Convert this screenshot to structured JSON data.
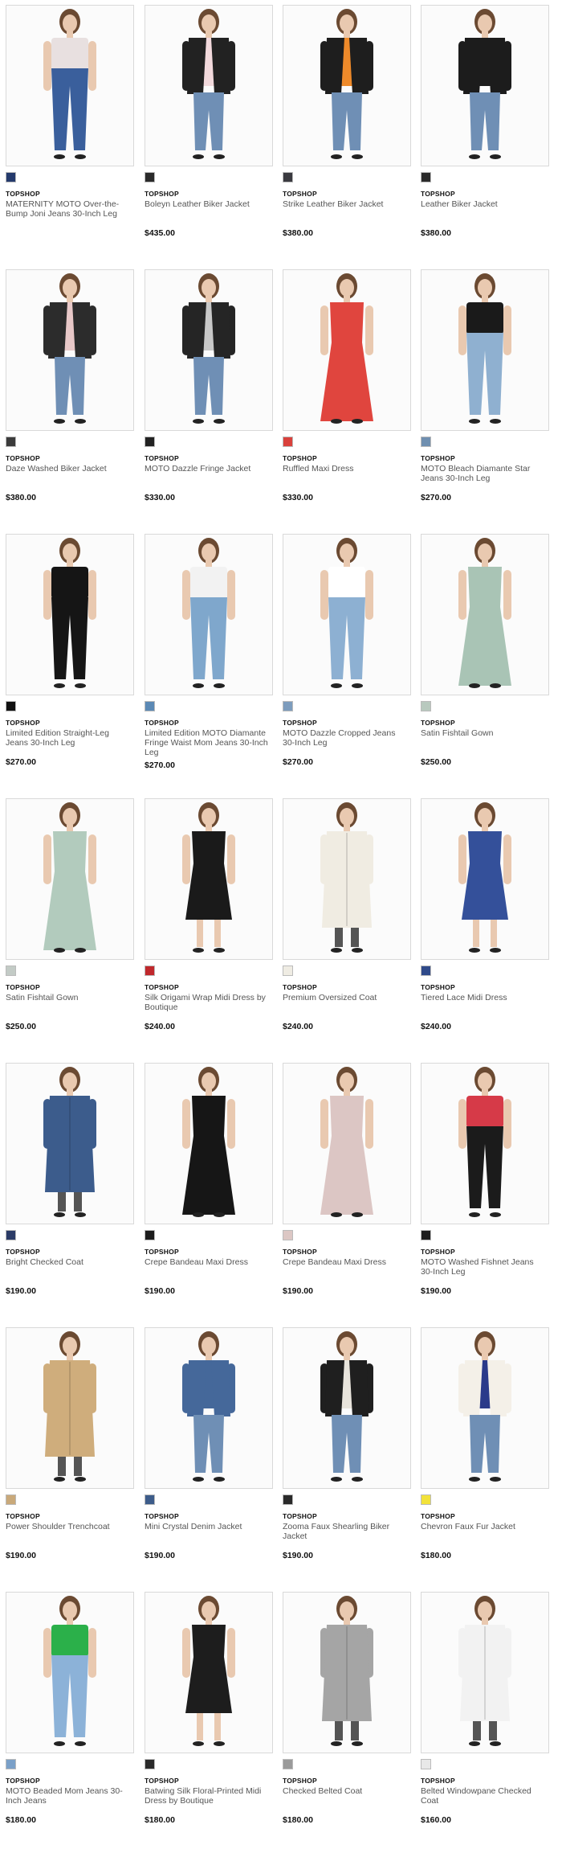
{
  "products": [
    {
      "brand": "TOPSHOP",
      "name": "MATERNITY MOTO Over-the-Bump Joni Jeans 30-Inch Leg",
      "price": "",
      "swatch": "#243a6c",
      "garment": "#3a5f9c",
      "top": "#e8e0e0",
      "style": "jeans"
    },
    {
      "brand": "TOPSHOP",
      "name": "Boleyn Leather Biker Jacket",
      "price": "$435.00",
      "swatch": "#2a2a2a",
      "garment": "#222222",
      "top": "#f2d9dc",
      "style": "jacket"
    },
    {
      "brand": "TOPSHOP",
      "name": "Strike Leather Biker Jacket",
      "price": "$380.00",
      "swatch": "#3a3a40",
      "garment": "#1e1e1e",
      "top": "#ee8a2a",
      "style": "jacket"
    },
    {
      "brand": "TOPSHOP",
      "name": "Leather Biker Jacket",
      "price": "$380.00",
      "swatch": "#2b2b2b",
      "garment": "#1c1c1c",
      "top": "#1c1c1c",
      "style": "jacket"
    },
    {
      "brand": "TOPSHOP",
      "name": "Daze Washed Biker Jacket",
      "price": "$380.00",
      "swatch": "#3b3b3b",
      "garment": "#2c2c2c",
      "top": "#e8c8c8",
      "style": "jacket"
    },
    {
      "brand": "TOPSHOP",
      "name": "MOTO Dazzle Fringe Jacket",
      "price": "$330.00",
      "swatch": "#222222",
      "garment": "#252525",
      "top": "#c8c8c8",
      "style": "jacket"
    },
    {
      "brand": "TOPSHOP",
      "name": "Ruffled Maxi Dress",
      "price": "$330.00",
      "swatch": "#d9413c",
      "garment": "#e0453e",
      "top": "#e0453e",
      "style": "gown"
    },
    {
      "brand": "TOPSHOP",
      "name": "MOTO Bleach Diamante Star Jeans 30-Inch Leg",
      "price": "$270.00",
      "swatch": "#6f8fb0",
      "garment": "#8fb0d0",
      "top": "#1a1a1a",
      "style": "jeans"
    },
    {
      "brand": "TOPSHOP",
      "name": "Limited Edition Straight-Leg Jeans 30-Inch Leg",
      "price": "$270.00",
      "swatch": "#111111",
      "garment": "#151515",
      "top": "#151515",
      "style": "jeans"
    },
    {
      "brand": "TOPSHOP",
      "name": "Limited Edition MOTO Diamante Fringe Waist Mom Jeans 30-Inch Leg",
      "price": "$270.00",
      "swatch": "#5b89b5",
      "garment": "#7fa7cc",
      "top": "#f2f2f2",
      "style": "jeans"
    },
    {
      "brand": "TOPSHOP",
      "name": "MOTO Dazzle Cropped Jeans 30-Inch Leg",
      "price": "$270.00",
      "swatch": "#7d9cbd",
      "garment": "#8db0d2",
      "top": "#ffffff",
      "style": "jeans"
    },
    {
      "brand": "TOPSHOP",
      "name": "Satin Fishtail Gown",
      "price": "$250.00",
      "swatch": "#b8c9be",
      "garment": "#a9c4b5",
      "top": "#a9c4b5",
      "style": "gown"
    },
    {
      "brand": "TOPSHOP",
      "name": "Satin Fishtail Gown",
      "price": "$250.00",
      "swatch": "#c3cbc6",
      "garment": "#b2cbbd",
      "top": "#b2cbbd",
      "style": "gown"
    },
    {
      "brand": "TOPSHOP",
      "name": "Silk Origami Wrap Midi Dress by Boutique",
      "price": "$240.00",
      "swatch": "#c0282c",
      "garment": "#1a1a1a",
      "top": "#c72a2e",
      "style": "dress"
    },
    {
      "brand": "TOPSHOP",
      "name": "Premium Oversized Coat",
      "price": "$240.00",
      "swatch": "#efece3",
      "garment": "#f0ece2",
      "top": "#f0ece2",
      "style": "coat"
    },
    {
      "brand": "TOPSHOP",
      "name": "Tiered Lace Midi Dress",
      "price": "$240.00",
      "swatch": "#2f4a8a",
      "garment": "#34509a",
      "top": "#34509a",
      "style": "dress"
    },
    {
      "brand": "TOPSHOP",
      "name": "Bright Checked Coat",
      "price": "$190.00",
      "swatch": "#2b3b66",
      "garment": "#3c5c8c",
      "top": "#3c5c8c",
      "style": "coat"
    },
    {
      "brand": "TOPSHOP",
      "name": "Crepe Bandeau Maxi Dress",
      "price": "$190.00",
      "swatch": "#1c1c1c",
      "garment": "#161616",
      "top": "#161616",
      "style": "gown"
    },
    {
      "brand": "TOPSHOP",
      "name": "Crepe Bandeau Maxi Dress",
      "price": "$190.00",
      "swatch": "#dcc7c4",
      "garment": "#dcc6c4",
      "top": "#dcc6c4",
      "style": "gown"
    },
    {
      "brand": "TOPSHOP",
      "name": "MOTO Washed Fishnet Jeans 30-Inch Leg",
      "price": "$190.00",
      "swatch": "#1e1e1e",
      "garment": "#1b1b1b",
      "top": "#d63a48",
      "style": "jeans"
    },
    {
      "brand": "TOPSHOP",
      "name": "Power Shoulder Trenchcoat",
      "price": "$190.00",
      "swatch": "#c9a97a",
      "garment": "#cfad7c",
      "top": "#cfad7c",
      "style": "coat"
    },
    {
      "brand": "TOPSHOP",
      "name": "Mini Crystal Denim Jacket",
      "price": "$190.00",
      "swatch": "#3d5c8a",
      "garment": "#45689a",
      "top": "#45689a",
      "style": "jacket"
    },
    {
      "brand": "TOPSHOP",
      "name": "Zooma Faux Shearling Biker Jacket",
      "price": "$190.00",
      "swatch": "#2a2a2a",
      "garment": "#1f1f1f",
      "top": "#e8e4dc",
      "style": "jacket"
    },
    {
      "brand": "TOPSHOP",
      "name": "Chevron Faux Fur Jacket",
      "price": "$180.00",
      "swatch": "#f2e23a",
      "garment": "#f4f0e8",
      "top": "#2a3a8a",
      "style": "jacket"
    },
    {
      "brand": "TOPSHOP",
      "name": "MOTO Beaded Mom Jeans 30-Inch Jeans",
      "price": "$180.00",
      "swatch": "#7aa0c8",
      "garment": "#8cb2d8",
      "top": "#2bb04a",
      "style": "jeans"
    },
    {
      "brand": "TOPSHOP",
      "name": "Batwing Silk Floral-Printed Midi Dress by Boutique",
      "price": "$180.00",
      "swatch": "#2a2a2a",
      "garment": "#1d1d1d",
      "top": "#1d1d1d",
      "style": "dress"
    },
    {
      "brand": "TOPSHOP",
      "name": "Checked Belted Coat",
      "price": "$180.00",
      "swatch": "#9a9a9a",
      "garment": "#a5a5a5",
      "top": "#2e8a3e",
      "style": "coat"
    },
    {
      "brand": "TOPSHOP",
      "name": "Belted Windowpane Checked Coat",
      "price": "$160.00",
      "swatch": "#e8e8e8",
      "garment": "#f2f2f2",
      "top": "#1a1a1a",
      "style": "coat"
    }
  ],
  "skin": "#e9c9b0",
  "hair": "#6b4a32"
}
